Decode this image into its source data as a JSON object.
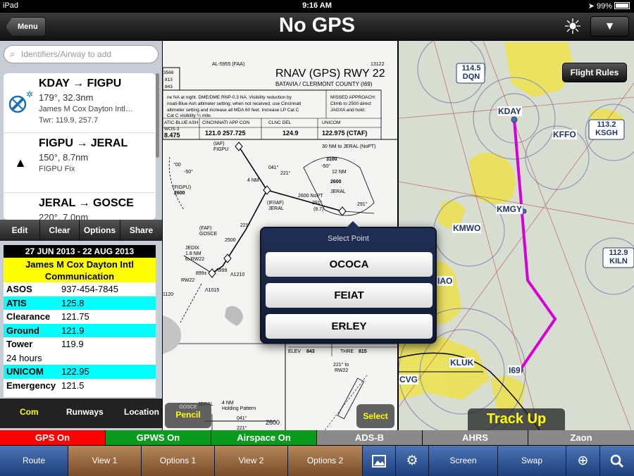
{
  "status_bar": {
    "device": "iPad",
    "time": "9:16 AM",
    "battery": "99%"
  },
  "header": {
    "menu_label": "Menu",
    "title": "No GPS",
    "dropdown_glyph": "▼"
  },
  "search": {
    "placeholder": "Identifiers/Airway to add"
  },
  "legs": [
    {
      "title": "KDAY → FIGPU",
      "line1": "179°, 32.3nm",
      "line2": "James M Cox Dayton Intl…",
      "line3": "Twr: 119.9, 257.7",
      "icon": "airport-icon"
    },
    {
      "title": "FIGPU → JERAL",
      "line1": "150°, 8.7nm",
      "line2": "FIGPU Fix",
      "line3": "",
      "icon": "fix-triangle-icon"
    },
    {
      "title": "JERAL → GOSCE",
      "line1": "220°, 7.0nm",
      "line2": "",
      "line3": "",
      "icon": "fix-triangle-icon"
    }
  ],
  "edit_bar": {
    "edit": "Edit",
    "clear": "Clear",
    "options": "Options",
    "share": "Share"
  },
  "frequencies": {
    "dates": "27 JUN 2013 - 22 AUG 2013",
    "airport": "James M Cox Dayton Intl Communication",
    "rows": [
      {
        "name": "ASOS",
        "value": "937-454-7845",
        "highlight": false
      },
      {
        "name": "ATIS",
        "value": "125.8",
        "highlight": true
      },
      {
        "name": "Clearance",
        "value": "121.75",
        "highlight": false
      },
      {
        "name": "Ground",
        "value": "121.9",
        "highlight": true
      },
      {
        "name": "Tower",
        "value": "119.9",
        "highlight": false
      },
      {
        "name": "24 hours",
        "value": "",
        "highlight": false
      },
      {
        "name": "UNICOM",
        "value": "122.95",
        "highlight": true
      },
      {
        "name": "Emergency",
        "value": "121.5",
        "highlight": false
      }
    ]
  },
  "com_tabs": {
    "com": "Com",
    "runways": "Runways",
    "location": "Location"
  },
  "plate": {
    "title": "RNAV (GPS) RWY 22",
    "subtitle": "BATAVIA / CLERMONT COUNTY (I69)",
    "doc_number": "AL-5955 (FAA)",
    "chart_number": "13122",
    "pencil_small": "GOSCE",
    "pencil_label": "Pencil",
    "select_label": "Select"
  },
  "popover": {
    "title": "Select Point",
    "options": [
      "OCOCA",
      "FEIAT",
      "ERLEY"
    ]
  },
  "map": {
    "flight_rules": "Flight Rules",
    "track_up": "Track Up",
    "route_color": "#d400d4",
    "labels": [
      "KDAY",
      "KFFO",
      "KMGY",
      "KMWO",
      "KLUK",
      "I69",
      "CVG",
      "IAO"
    ],
    "vor_dqn": [
      "114.5",
      "DQN"
    ],
    "vor_ksgh": [
      "113.2",
      "KSGH"
    ],
    "vor_kiln": [
      "112.9",
      "KILN"
    ]
  },
  "status_strip": [
    {
      "label": "GPS On",
      "bg": "#ff0000",
      "color": "#ffffff"
    },
    {
      "label": "GPWS On",
      "bg": "#0c9a1e",
      "color": "#ffffff"
    },
    {
      "label": "Airspace On",
      "bg": "#0c9a1e",
      "color": "#ffffff"
    },
    {
      "label": "ADS-B",
      "bg": "#8a8a8a",
      "color": "#ffffff"
    },
    {
      "label": "AHRS",
      "bg": "#8a8a8a",
      "color": "#ffffff"
    },
    {
      "label": "Zaon",
      "bg": "#8a8a8a",
      "color": "#ffffff"
    }
  ],
  "bottom_bar": {
    "route": "Route",
    "view1": "View 1",
    "options1": "Options 1",
    "view2": "View 2",
    "options2": "Options 2",
    "screen": "Screen",
    "swap": "Swap"
  }
}
